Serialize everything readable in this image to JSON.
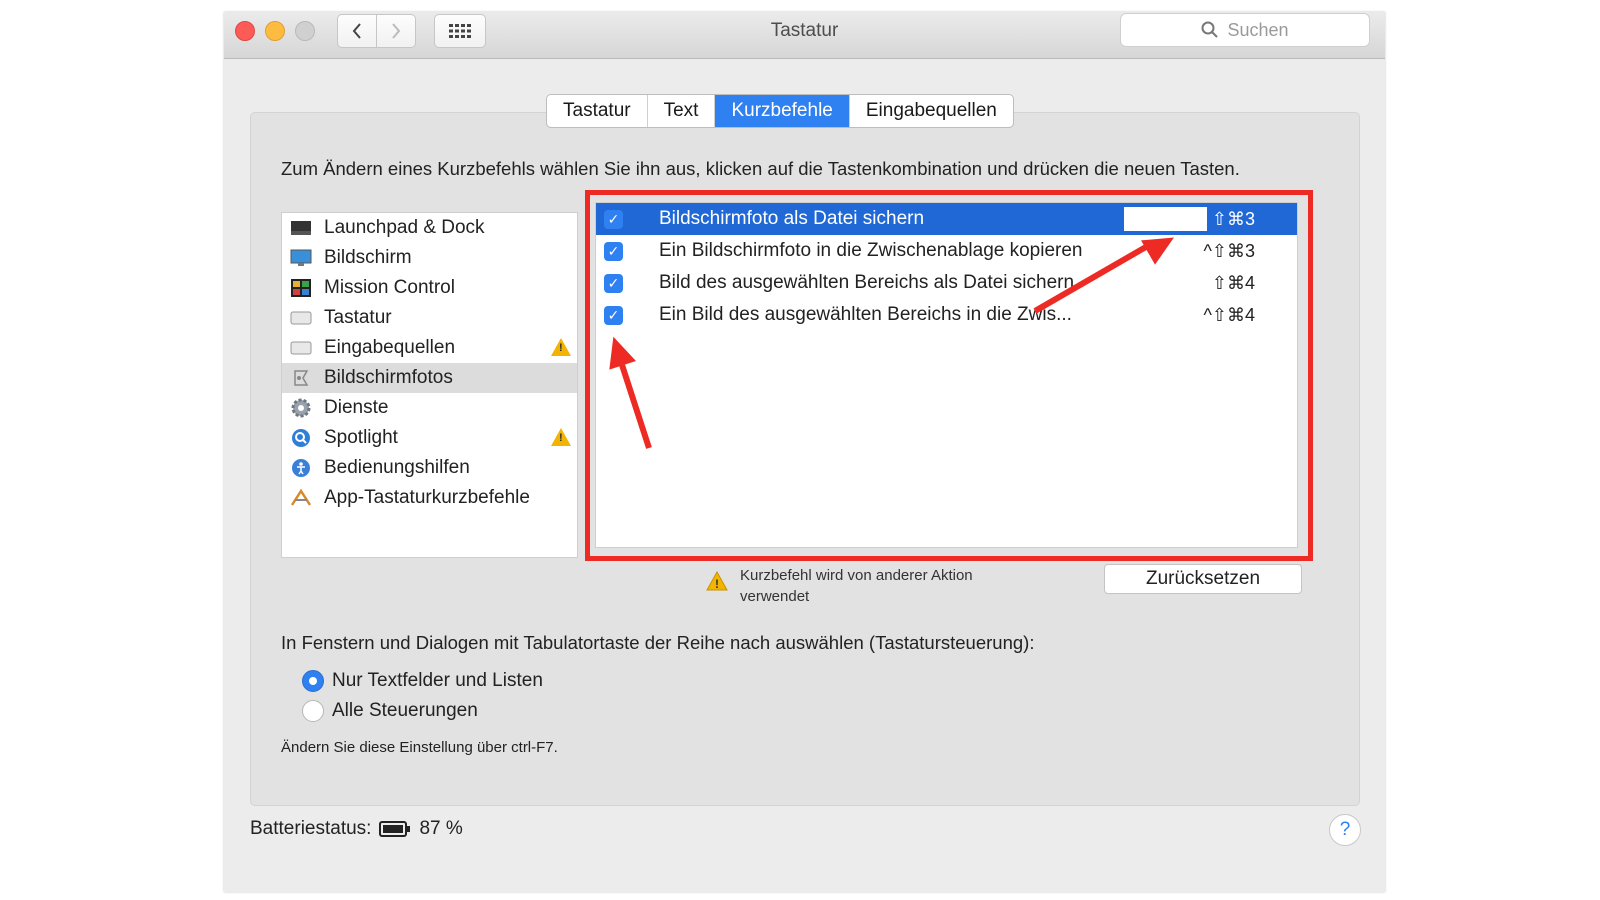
{
  "window": {
    "title": "Tastatur",
    "search_placeholder": "Suchen"
  },
  "tabs": [
    {
      "label": "Tastatur",
      "active": false
    },
    {
      "label": "Text",
      "active": false
    },
    {
      "label": "Kurzbefehle",
      "active": true
    },
    {
      "label": "Eingabequellen",
      "active": false
    }
  ],
  "instruction": "Zum Ändern eines Kurzbefehls wählen Sie ihn aus, klicken auf die Tastenkombination und drücken die neuen Tasten.",
  "categories": [
    {
      "label": "Launchpad & Dock",
      "icon": "launchpad-icon",
      "warning": false,
      "selected": false
    },
    {
      "label": "Bildschirm",
      "icon": "display-icon",
      "warning": false,
      "selected": false
    },
    {
      "label": "Mission Control",
      "icon": "mission-control-icon",
      "warning": false,
      "selected": false
    },
    {
      "label": "Tastatur",
      "icon": "keyboard-icon",
      "warning": false,
      "selected": false
    },
    {
      "label": "Eingabequellen",
      "icon": "input-sources-icon",
      "warning": true,
      "selected": false
    },
    {
      "label": "Bildschirmfotos",
      "icon": "screenshot-icon",
      "warning": false,
      "selected": true
    },
    {
      "label": "Dienste",
      "icon": "services-gear-icon",
      "warning": false,
      "selected": false
    },
    {
      "label": "Spotlight",
      "icon": "spotlight-icon",
      "warning": true,
      "selected": false
    },
    {
      "label": "Bedienungshilfen",
      "icon": "accessibility-icon",
      "warning": false,
      "selected": false
    },
    {
      "label": "App-Tastaturkurzbefehle",
      "icon": "app-shortcuts-icon",
      "warning": false,
      "selected": false
    }
  ],
  "shortcuts": [
    {
      "label": "Bildschirmfoto als Datei sichern",
      "keys": "⇧⌘3",
      "checked": true,
      "selected": true
    },
    {
      "label": "Ein Bildschirmfoto in die Zwischenablage kopieren",
      "keys": "^⇧⌘3",
      "checked": true,
      "selected": false
    },
    {
      "label": "Bild des ausgewählten Bereichs als Datei sichern",
      "keys": "⇧⌘4",
      "checked": true,
      "selected": false
    },
    {
      "label": "Ein Bild des ausgewählten Bereichs in die Zwis...",
      "keys": "^⇧⌘4",
      "checked": true,
      "selected": false
    }
  ],
  "conflict": {
    "line1": "Kurzbefehl wird von anderer Aktion",
    "line2": "verwendet"
  },
  "reset_label": "Zurücksetzen",
  "tab_nav": {
    "label": "In Fenstern und Dialogen mit Tabulatortaste der Reihe nach auswählen (Tastatursteuerung):",
    "options": [
      {
        "label": "Nur Textfelder und Listen",
        "selected": true
      },
      {
        "label": "Alle Steuerungen",
        "selected": false
      }
    ],
    "hint": "Ändern Sie diese Einstellung über ctrl-F7."
  },
  "battery": {
    "label": "Batteriestatus:",
    "value": "87 %"
  },
  "help_label": "?",
  "colors": {
    "accent": "#2f80f0",
    "selection": "#1f68d6",
    "annotation_red": "#ee2a24",
    "warning": "#f2b400"
  }
}
